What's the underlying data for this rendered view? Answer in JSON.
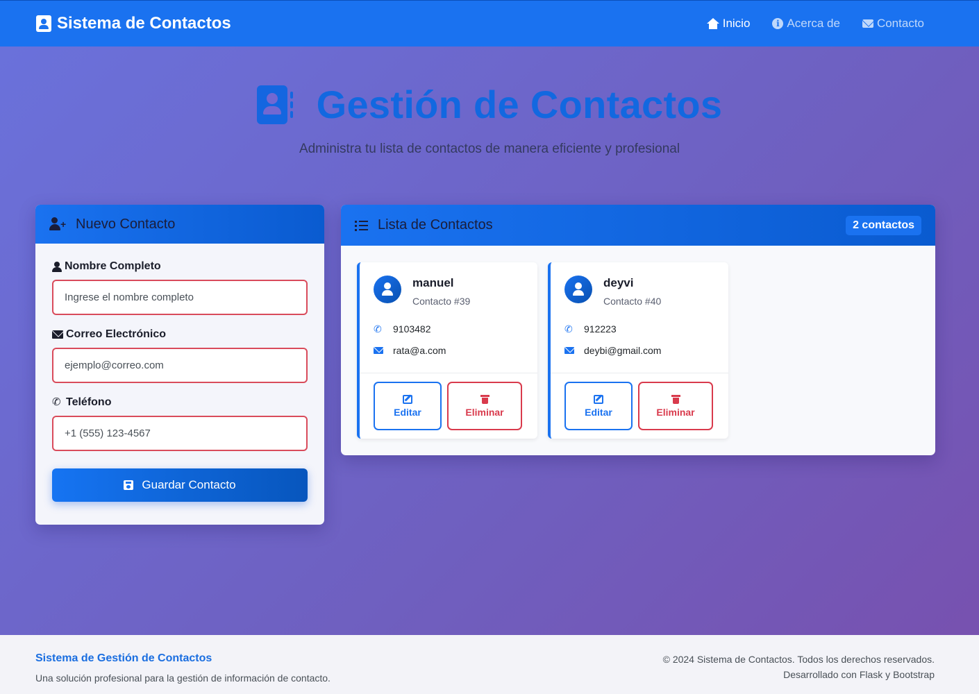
{
  "navbar": {
    "brand": "Sistema de Contactos",
    "links": [
      {
        "label": "Inicio",
        "icon": "home-icon",
        "active": true
      },
      {
        "label": "Acerca de",
        "icon": "info-icon",
        "active": false
      },
      {
        "label": "Contacto",
        "icon": "envelope-icon",
        "active": false
      }
    ]
  },
  "hero": {
    "title": "Gestión de Contactos",
    "subtitle": "Administra tu lista de contactos de manera eficiente y profesional"
  },
  "form": {
    "header": "Nuevo Contacto",
    "name_label": "Nombre Completo",
    "name_placeholder": "Ingrese el nombre completo",
    "email_label": "Correo Electrónico",
    "email_placeholder": "ejemplo@correo.com",
    "phone_label": "Teléfono",
    "phone_placeholder": "+1 (555) 123-4567",
    "save_label": "Guardar Contacto"
  },
  "list": {
    "header": "Lista de Contactos",
    "count": "2 contactos",
    "contacts": [
      {
        "name": "manuel",
        "id": "Contacto #39",
        "phone": "9103482",
        "email": "rata@a.com"
      },
      {
        "name": "deyvi",
        "id": "Contacto #40",
        "phone": "912223",
        "email": "deybi@gmail.com"
      }
    ],
    "edit_label": "Editar",
    "delete_label": "Eliminar"
  },
  "footer": {
    "title": "Sistema de Gestión de Contactos",
    "description": "Una solución profesional para la gestión de información de contacto.",
    "copyright": "© 2024 Sistema de Contactos. Todos los derechos reservados.",
    "developed": "Desarrollado con Flask y Bootstrap"
  },
  "colors": {
    "primary": "#1a72f0",
    "danger": "#d93a4c",
    "background_start": "#6a72dc",
    "background_end": "#7850ae"
  }
}
